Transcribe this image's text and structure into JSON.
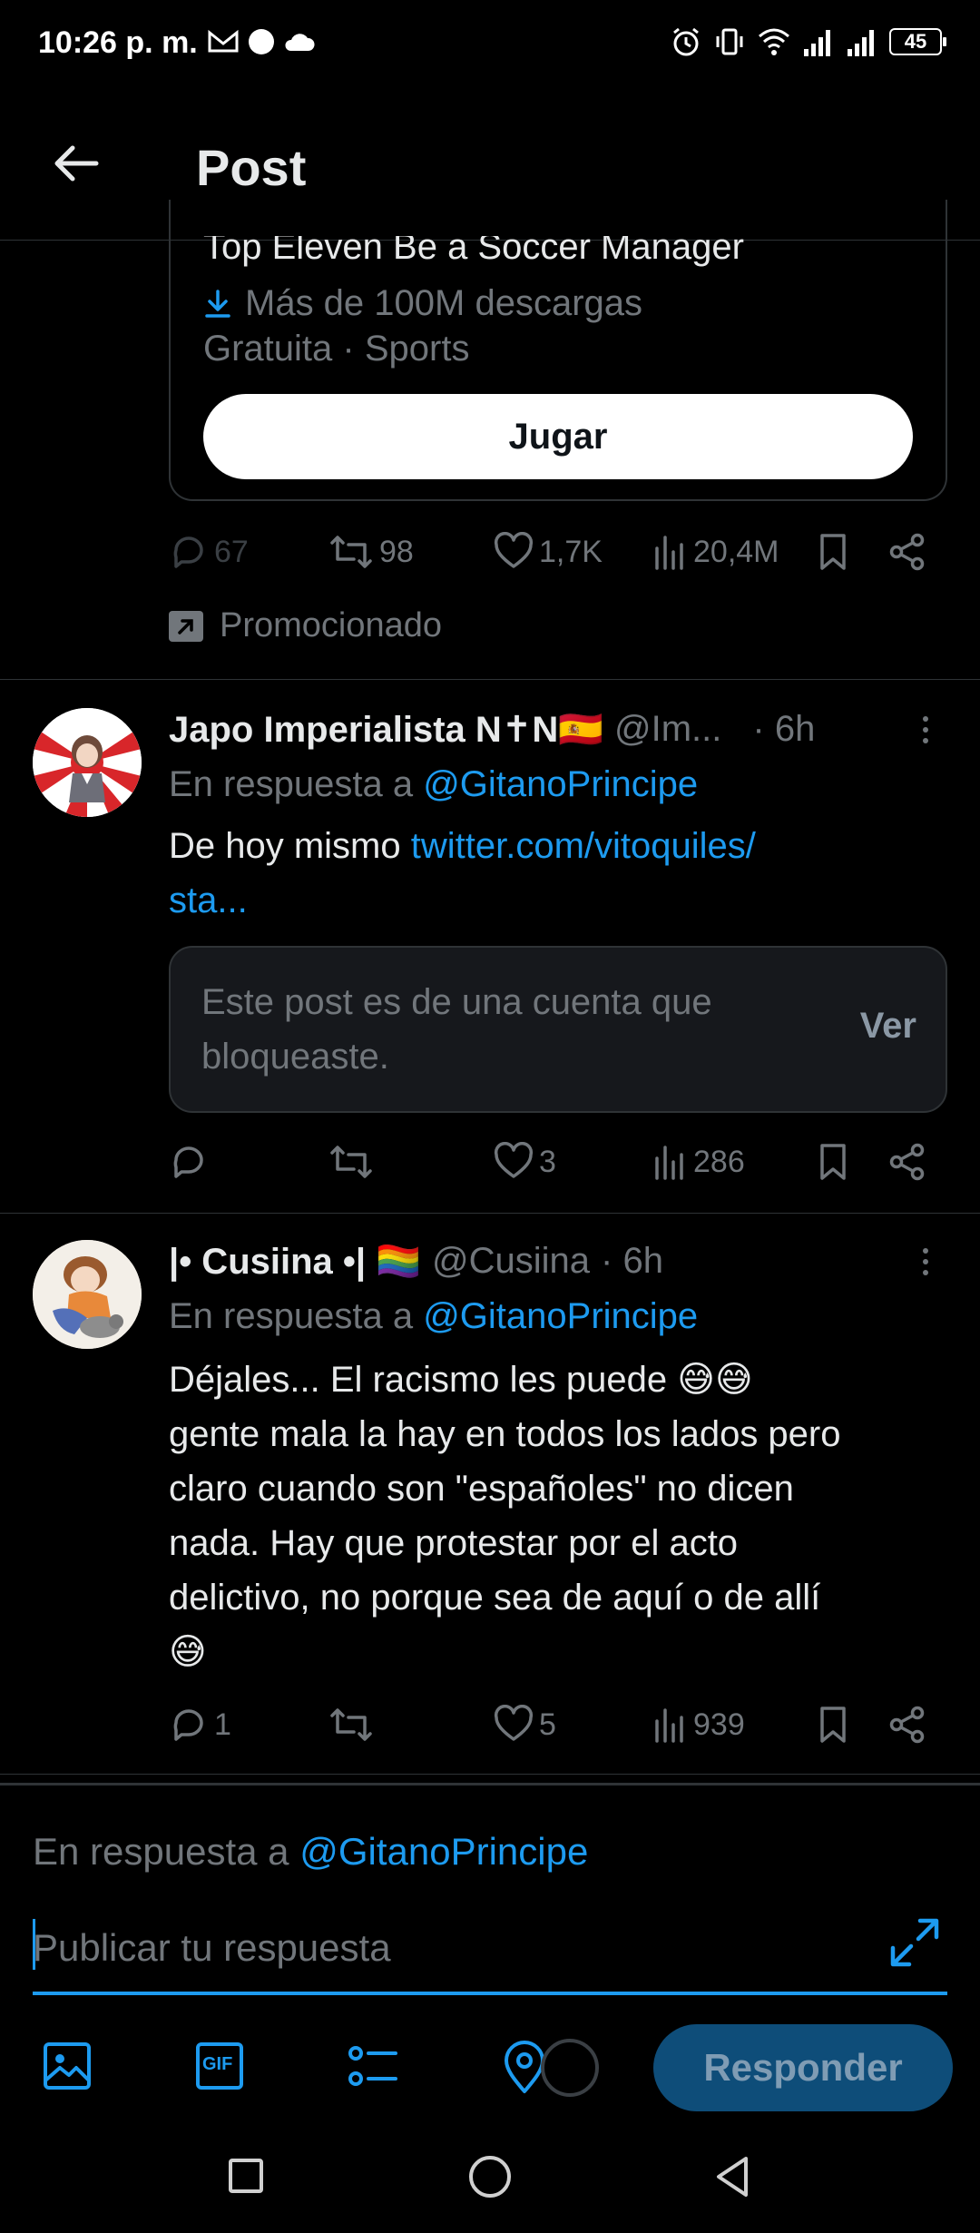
{
  "status_bar": {
    "time": "10:26 p. m.",
    "battery": "45"
  },
  "header": {
    "title": "Post"
  },
  "ad": {
    "app_name": "Top Eleven Be a Soccer Manager",
    "downloads": "Más de 100M descargas",
    "meta": "Gratuita · Sports",
    "play_label": "Jugar",
    "stats": {
      "replies": "67",
      "reposts": "98",
      "likes": "1,7K",
      "views": "20,4M"
    },
    "promoted_label": "Promocionado"
  },
  "posts": [
    {
      "name": "Japo Imperialista N✝N🇪🇸",
      "handle": "@Im...",
      "time": "· 6h",
      "reply_to_prefix": "En respuesta a ",
      "reply_to_handle": "@GitanoPrincipe",
      "text_prefix": "De hoy mismo ",
      "text_link": "twitter.com/vitoquiles/",
      "text_link_2": "sta...",
      "blocked_text": "Este post es de una cuenta que bloqueaste.",
      "blocked_button": "Ver",
      "stats": {
        "replies": "",
        "reposts": "",
        "likes": "3",
        "views": "286"
      }
    },
    {
      "name": "|• Cusiina •| 🏳️‍🌈",
      "handle": "@Cusiina",
      "time": "· 6h",
      "reply_to_prefix": "En respuesta a ",
      "reply_to_handle": "@GitanoPrincipe",
      "text_lines": [
        "Déjales... El racismo les puede 😅😅",
        "gente mala la hay en todos los lados pero",
        "claro cuando son \"españoles\" no dicen",
        "nada. Hay que protestar por el acto",
        "delictivo, no porque sea de aquí o de allí",
        "😅"
      ],
      "stats": {
        "replies": "1",
        "reposts": "",
        "likes": "5",
        "views": "939"
      }
    }
  ],
  "composer": {
    "reply_to_prefix": "En respuesta a ",
    "reply_to_handle": "@GitanoPrincipe",
    "placeholder": "Publicar tu respuesta",
    "submit_label": "Responder",
    "gif_label": "GIF"
  },
  "colors": {
    "background": "#000000",
    "text": "#e7e9ea",
    "muted": "#71767b",
    "accent": "#1d9bf0",
    "divider": "#2f3336"
  }
}
